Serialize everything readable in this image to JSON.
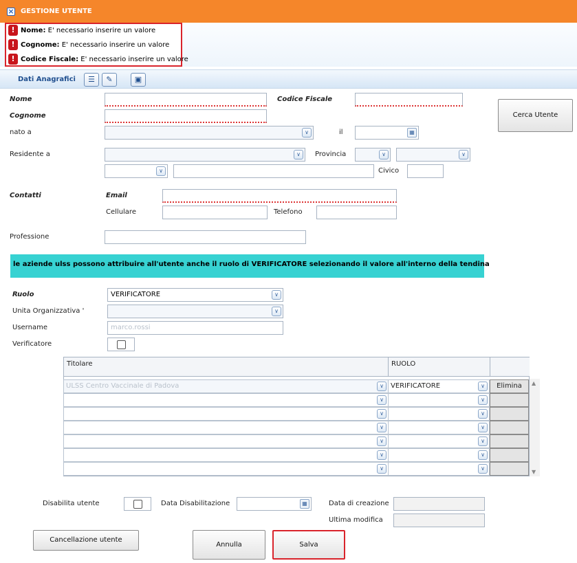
{
  "window": {
    "title": "GESTIONE UTENTE"
  },
  "errors": [
    {
      "field": "Nome:",
      "message": " E' necessario inserire un valore"
    },
    {
      "field": "Cognome:",
      "message": " E' necessario inserire un valore"
    },
    {
      "field": "Codice Fiscale:",
      "message": " E' necessario inserire un valore"
    }
  ],
  "section": {
    "title": "Dati Anagrafici"
  },
  "labels": {
    "nome": "Nome",
    "cognome": "Cognome",
    "codice_fiscale": "Codice Fiscale",
    "nato_a": "nato a",
    "il": "il",
    "residente_a": "Residente a",
    "provincia": "Provincia",
    "civico": "Civico",
    "contatti": "Contatti",
    "email": "Email",
    "cellulare": "Cellulare",
    "telefono": "Telefono",
    "professione": "Professione",
    "ruolo": "Ruolo",
    "unita_organizzativa": "Unita Organizzativa '",
    "username": "Username",
    "verificatore": "Verificatore",
    "disabilita_utente": "Disabilita utente",
    "data_disabilitazione": "Data Disabilitazione",
    "data_creazione": "Data di creazione",
    "ultima_modifica": "Ultima modifica"
  },
  "buttons": {
    "cerca_utente": "Cerca Utente",
    "cancellazione_utente": "Cancellazione utente",
    "annulla": "Annulla",
    "salva": "Salva",
    "elimina": "Elimina"
  },
  "info_message": "le aziende ulss possono attribuire all'utente anche il ruolo di VERIFICATORE selezionando il valore all'interno della tendina",
  "values": {
    "ruolo": "VERIFICATORE",
    "username": "marco.rossi"
  },
  "grid": {
    "columns": [
      "Titolare",
      "RUOLO"
    ],
    "rows": [
      {
        "titolare": "ULSS Centro Vaccinale di Padova",
        "ruolo": "VERIFICATORE",
        "action": "Elimina"
      },
      {
        "titolare": "",
        "ruolo": "",
        "action": ""
      },
      {
        "titolare": "",
        "ruolo": "",
        "action": ""
      },
      {
        "titolare": "",
        "ruolo": "",
        "action": ""
      },
      {
        "titolare": "",
        "ruolo": "",
        "action": ""
      },
      {
        "titolare": "",
        "ruolo": "",
        "action": ""
      },
      {
        "titolare": "",
        "ruolo": "",
        "action": ""
      }
    ]
  },
  "icons": {
    "close": "close-icon",
    "error": "error-icon",
    "list": "list-icon",
    "edit": "edit-icon",
    "save": "save-icon",
    "dropdown": "chevron-down-icon",
    "calendar": "calendar-icon"
  },
  "colors": {
    "titlebar": "#f5862a",
    "error_border": "#d9232b",
    "info_bar": "#37d2d2",
    "section_text": "#1f4f8f"
  }
}
